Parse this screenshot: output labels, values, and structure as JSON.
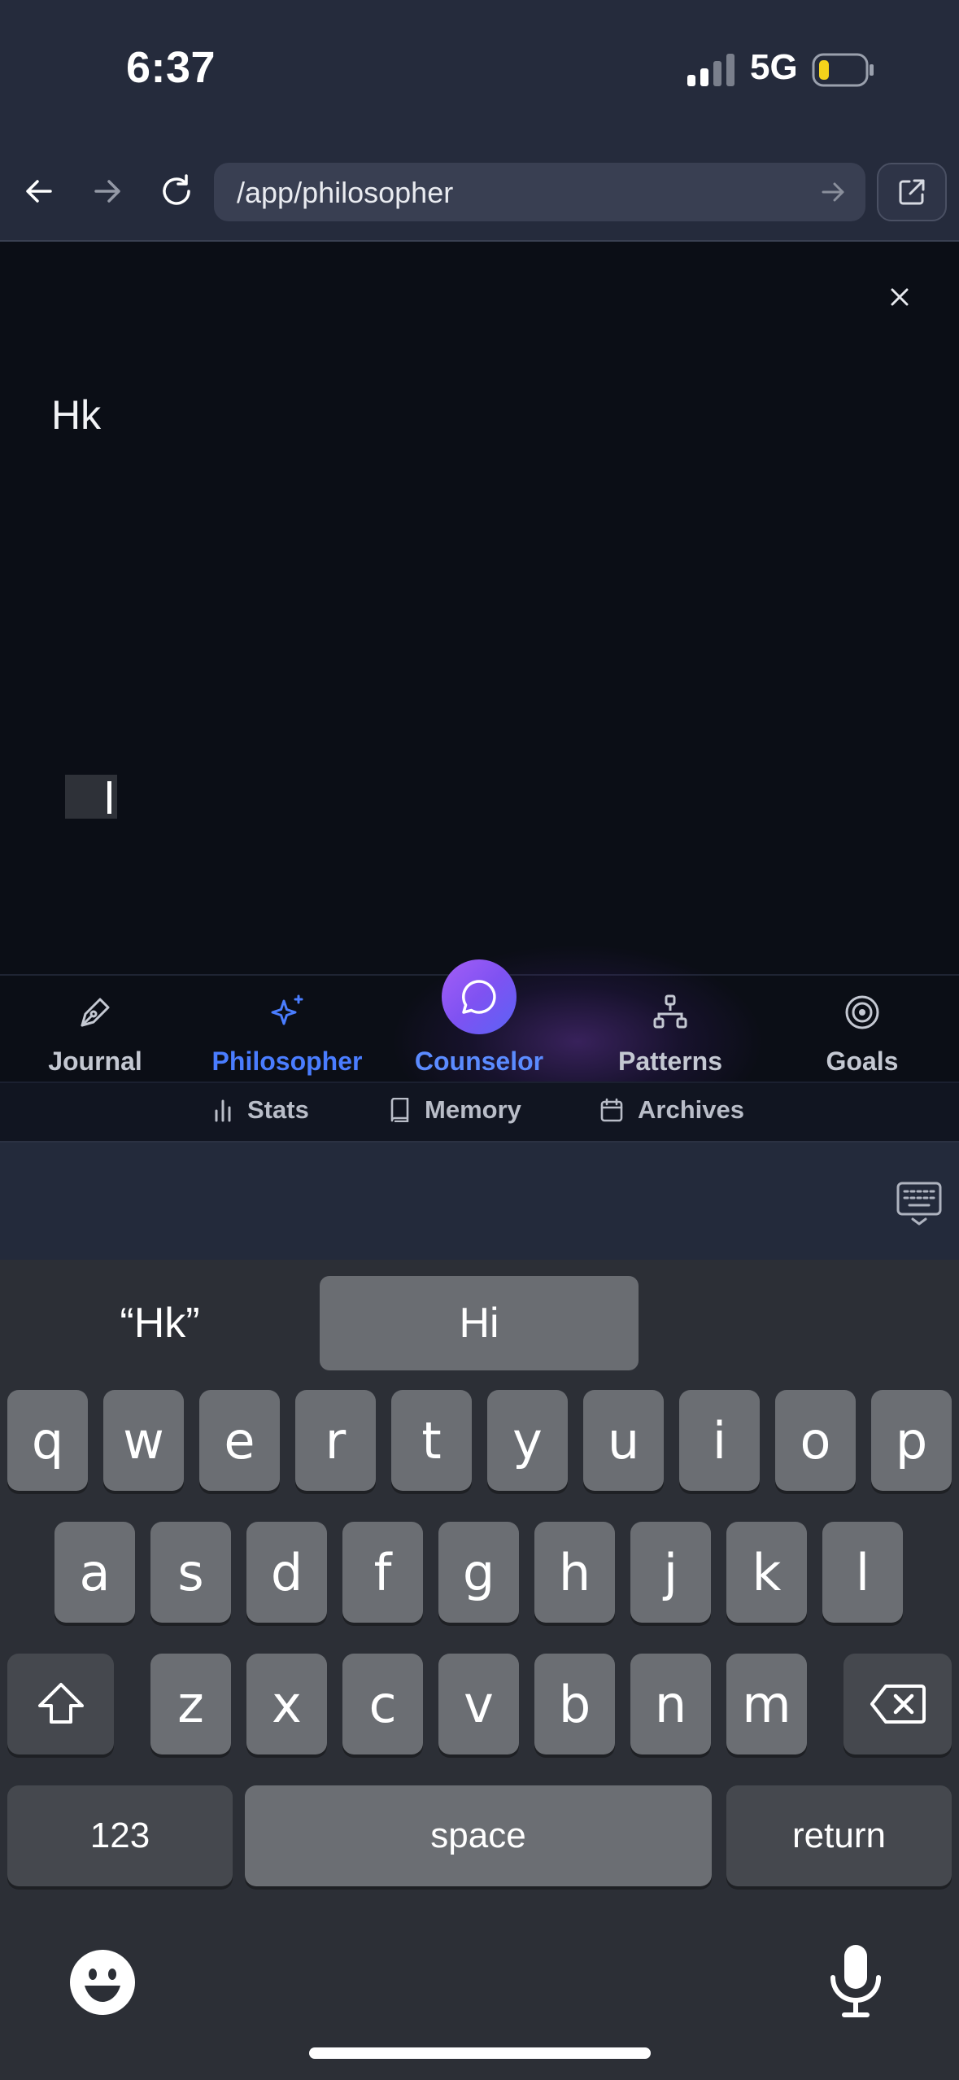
{
  "status": {
    "time": "6:37",
    "network": "5G"
  },
  "browser": {
    "url": "/app/philosopher"
  },
  "page": {
    "entry_text": "Hk"
  },
  "nav": {
    "tabs": [
      {
        "label": "Journal",
        "icon": "pen-nib-icon"
      },
      {
        "label": "Philosopher",
        "icon": "sparkle-icon",
        "active": true
      },
      {
        "label": "Counselor",
        "icon": "chat-bubble-icon"
      },
      {
        "label": "Patterns",
        "icon": "hierarchy-icon"
      },
      {
        "label": "Goals",
        "icon": "target-icon"
      }
    ],
    "secondary": [
      {
        "label": "Stats",
        "icon": "bar-chart-icon"
      },
      {
        "label": "Memory",
        "icon": "book-icon"
      },
      {
        "label": "Archives",
        "icon": "calendar-icon"
      }
    ]
  },
  "keyboard": {
    "suggestions": [
      "“Hk”",
      "Hi",
      ""
    ],
    "row1": [
      "q",
      "w",
      "e",
      "r",
      "t",
      "y",
      "u",
      "i",
      "o",
      "p"
    ],
    "row2": [
      "a",
      "s",
      "d",
      "f",
      "g",
      "h",
      "j",
      "k",
      "l"
    ],
    "row3": [
      "z",
      "x",
      "c",
      "v",
      "b",
      "n",
      "m"
    ],
    "numbers_label": "123",
    "space_label": "space",
    "return_label": "return"
  },
  "colors": {
    "accent": "#4a7dff",
    "fab_gradient_start": "#a45ef6",
    "fab_gradient_end": "#5a63f5",
    "background": "#0b0e16"
  }
}
